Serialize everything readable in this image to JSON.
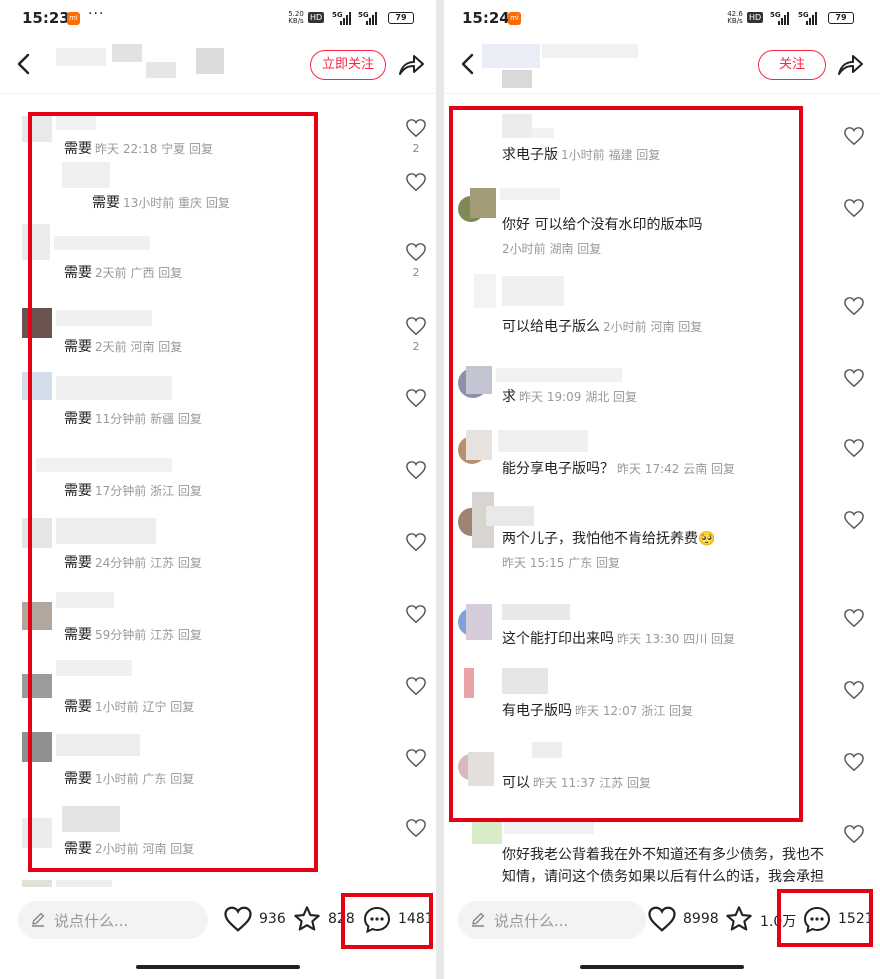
{
  "left": {
    "status": {
      "time": "15:23",
      "speed": "5.20\nKB/s",
      "hd": "HD",
      "net1": "5G",
      "net2": "5G",
      "battery": "79"
    },
    "nav": {
      "follow_label": "立即关注"
    },
    "comments": [
      {
        "keyword": "需要",
        "meta": "昨天 22:18 宁夏 回复",
        "likes": "2"
      },
      {
        "keyword": "需要",
        "meta": "13小时前 重庆 回复",
        "likes": ""
      },
      {
        "keyword": "需要",
        "meta": "2天前 广西 回复",
        "likes": "2"
      },
      {
        "keyword": "需要",
        "meta": "2天前 河南 回复",
        "likes": "2"
      },
      {
        "keyword": "需要",
        "meta": "11分钟前 新疆 回复",
        "likes": ""
      },
      {
        "keyword": "需要",
        "meta": "17分钟前 浙江 回复",
        "likes": ""
      },
      {
        "keyword": "需要",
        "meta": "24分钟前 江苏 回复",
        "likes": ""
      },
      {
        "keyword": "需要",
        "meta": "59分钟前 江苏 回复",
        "likes": ""
      },
      {
        "keyword": "需要",
        "meta": "1小时前 辽宁 回复",
        "likes": ""
      },
      {
        "keyword": "需要",
        "meta": "1小时前 广东 回复",
        "likes": ""
      },
      {
        "keyword": "需要",
        "meta": "2小时前 河南 回复",
        "likes": ""
      }
    ],
    "bottom": {
      "placeholder": "说点什么...",
      "likes": "936",
      "stars": "828",
      "comments": "1481"
    }
  },
  "right": {
    "status": {
      "time": "15:24",
      "speed": "42.6\nKB/s",
      "hd": "HD",
      "net1": "5G",
      "net2": "5G",
      "battery": "79"
    },
    "nav": {
      "follow_label": "关注"
    },
    "comments": [
      {
        "text": "求电子版",
        "meta": "1小时前 福建 回复"
      },
      {
        "text": "你好 可以给个没有水印的版本吗",
        "meta": "2小时前 湖南 回复"
      },
      {
        "text": "可以给电子版么",
        "meta": "2小时前 河南 回复"
      },
      {
        "text": "求",
        "meta": "昨天 19:09 湖北 回复"
      },
      {
        "text": "能分享电子版吗？",
        "meta": "昨天 17:42 云南 回复"
      },
      {
        "text": "两个儿子，我怕他不肯给抚养费🥺",
        "meta": "昨天 15:15 广东 回复"
      },
      {
        "text": "这个能打印出来吗",
        "meta": "昨天 13:30 四川 回复"
      },
      {
        "text": "有电子版吗",
        "meta": "昨天 12:07 浙江 回复"
      },
      {
        "text": "可以",
        "meta": "昨天 11:37 江苏 回复"
      },
      {
        "text": "你好我老公背着我在外不知道还有多少债务，我也不知情，请问这个债务如果以后有什么的话，我会承担吗？我也没有签字什么的",
        "meta": ""
      }
    ],
    "bottom": {
      "placeholder": "说点什么...",
      "likes": "8998",
      "stars": "1.0万",
      "comments": "1521"
    }
  },
  "colors": {
    "accent": "#ff2442",
    "highlight": "#e50014"
  }
}
